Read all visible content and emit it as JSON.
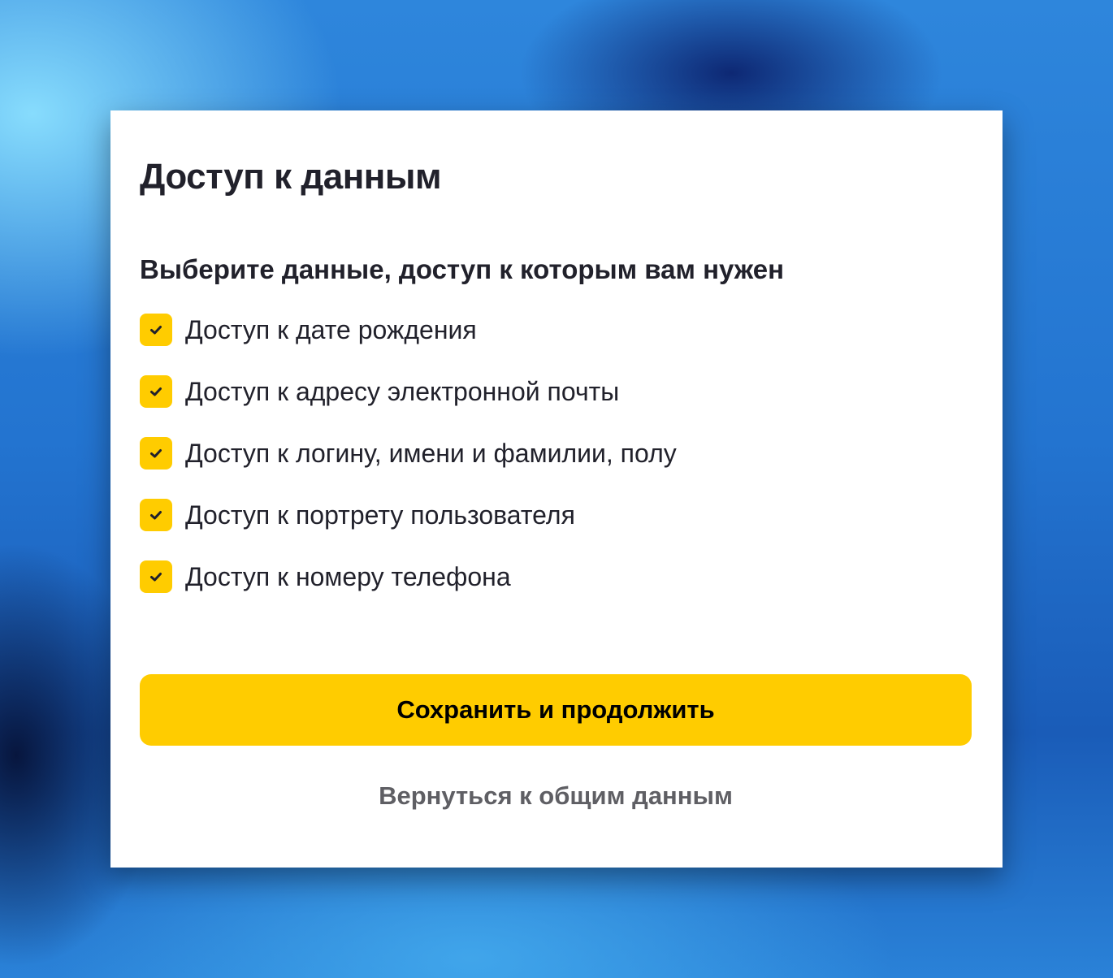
{
  "dialog": {
    "title": "Доступ к данным",
    "subtitle": "Выберите данные, доступ к которым вам нужен",
    "options": [
      {
        "label": "Доступ к дате рождения",
        "checked": true
      },
      {
        "label": "Доступ к адресу электронной почты",
        "checked": true
      },
      {
        "label": "Доступ к логину, имени и фамилии, полу",
        "checked": true
      },
      {
        "label": "Доступ к портрету пользователя",
        "checked": true
      },
      {
        "label": "Доступ к номеру телефона",
        "checked": true
      }
    ],
    "primary_button": "Сохранить и продолжить",
    "back_link": "Вернуться к общим данным"
  },
  "colors": {
    "accent": "#ffcc00",
    "text": "#21212b",
    "secondary_text": "#5f5f64",
    "check_mark": "#21212b"
  },
  "icons": {
    "checkbox_mark": "check-icon"
  }
}
